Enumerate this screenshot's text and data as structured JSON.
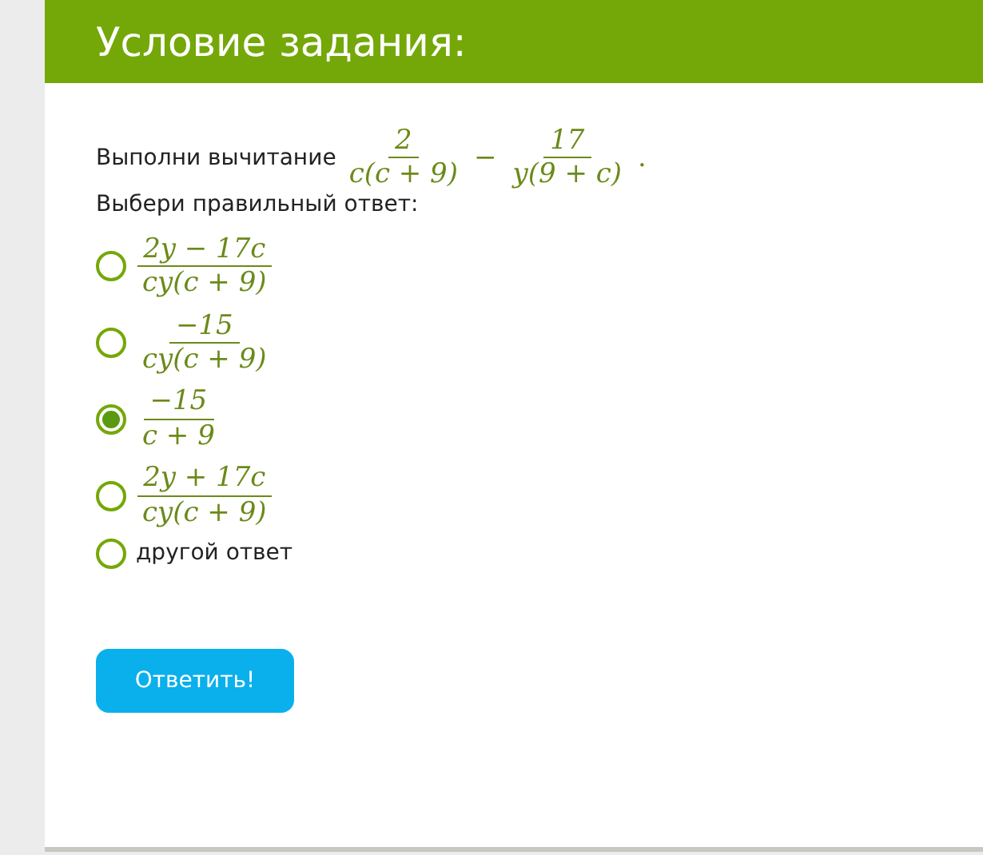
{
  "header": {
    "title": "Условие задания:"
  },
  "task": {
    "prompt": "Выполни вычитание",
    "expression": [
      {
        "kind": "fraction",
        "numerator": "2",
        "denominator": "c(c + 9)"
      },
      {
        "kind": "operator",
        "text": "−"
      },
      {
        "kind": "fraction",
        "numerator": "17",
        "denominator": "y(9 + c)"
      },
      {
        "kind": "operator",
        "text": "."
      }
    ]
  },
  "instruction": "Выбери правильный ответ:",
  "options": [
    {
      "kind": "fraction",
      "numerator": "2y − 17c",
      "denominator": "cy(c + 9)",
      "selected": false
    },
    {
      "kind": "fraction",
      "numerator": "−15",
      "denominator": "cy(c + 9)",
      "selected": false
    },
    {
      "kind": "fraction",
      "numerator": "−15",
      "denominator": "c + 9",
      "selected": true
    },
    {
      "kind": "fraction",
      "numerator": "2y + 17c",
      "denominator": "cy(c + 9)",
      "selected": false
    },
    {
      "kind": "text",
      "text": "другой ответ",
      "selected": false
    }
  ],
  "submit_button": "Ответить!"
}
